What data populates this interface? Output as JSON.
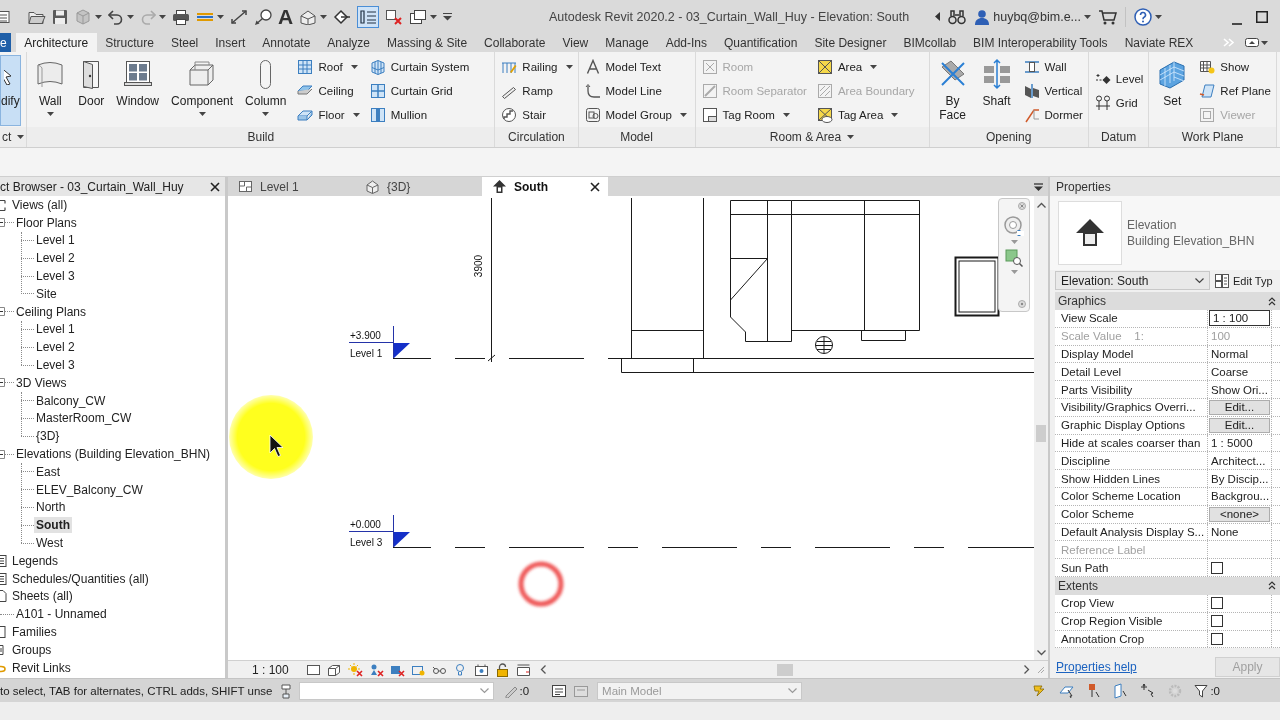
{
  "title_bar": {
    "title": "Autodesk Revit 2020.2 - 03_Curtain_Wall_Huy - Elevation: South",
    "user": "huybq@bim.e..."
  },
  "quick_access": {
    "text_glyph": "A",
    "thin_lines": true
  },
  "ribbon_tabs": [
    {
      "label": "e",
      "kind": "file",
      "selected": false
    },
    {
      "label": "Architecture",
      "kind": "tab",
      "selected": true
    },
    {
      "label": "Structure",
      "kind": "tab",
      "selected": false
    },
    {
      "label": "Steel",
      "kind": "tab",
      "selected": false
    },
    {
      "label": "Insert",
      "kind": "tab",
      "selected": false
    },
    {
      "label": "Annotate",
      "kind": "tab",
      "selected": false
    },
    {
      "label": "Analyze",
      "kind": "tab",
      "selected": false
    },
    {
      "label": "Massing & Site",
      "kind": "tab",
      "selected": false
    },
    {
      "label": "Collaborate",
      "kind": "tab",
      "selected": false
    },
    {
      "label": "View",
      "kind": "tab",
      "selected": false
    },
    {
      "label": "Manage",
      "kind": "tab",
      "selected": false
    },
    {
      "label": "Add-Ins",
      "kind": "tab",
      "selected": false
    },
    {
      "label": "Quantification",
      "kind": "tab",
      "selected": false
    },
    {
      "label": "Site Designer",
      "kind": "tab",
      "selected": false
    },
    {
      "label": "BIMcollab",
      "kind": "tab",
      "selected": false
    },
    {
      "label": "BIM Interoperability Tools",
      "kind": "tab",
      "selected": false
    },
    {
      "label": "Naviate REX",
      "kind": "tab",
      "selected": false
    }
  ],
  "ribbon_panels": [
    {
      "label": "ct",
      "dropdown": true,
      "tools": [
        {
          "label": "dify",
          "kind": "large",
          "active": true,
          "disabled": false,
          "dropdown": false
        }
      ]
    },
    {
      "label": "Build",
      "dropdown": false,
      "tools": [
        {
          "label": "Wall",
          "kind": "large",
          "active": false,
          "disabled": false,
          "dropdown": true
        },
        {
          "label": "Door",
          "kind": "large",
          "active": false,
          "disabled": false,
          "dropdown": false
        },
        {
          "label": "Window",
          "kind": "large",
          "active": false,
          "disabled": false,
          "dropdown": false
        },
        {
          "label": "Component",
          "kind": "large",
          "active": false,
          "disabled": false,
          "dropdown": true
        },
        {
          "label": "Column",
          "kind": "large",
          "active": false,
          "disabled": false,
          "dropdown": true
        },
        {
          "label": "Roof",
          "kind": "small",
          "active": false,
          "disabled": false,
          "dropdown": true
        },
        {
          "label": "Ceiling",
          "kind": "small",
          "active": false,
          "disabled": false,
          "dropdown": false
        },
        {
          "label": "Floor",
          "kind": "small",
          "active": false,
          "disabled": false,
          "dropdown": true
        },
        {
          "label": "Curtain System",
          "kind": "small",
          "active": false,
          "disabled": false,
          "dropdown": false
        },
        {
          "label": "Curtain Grid",
          "kind": "small",
          "active": false,
          "disabled": false,
          "dropdown": false
        },
        {
          "label": "Mullion",
          "kind": "small",
          "active": false,
          "disabled": false,
          "dropdown": false
        }
      ]
    },
    {
      "label": "Circulation",
      "dropdown": false,
      "tools": [
        {
          "label": "Railing",
          "kind": "small",
          "active": false,
          "disabled": false,
          "dropdown": true
        },
        {
          "label": "Ramp",
          "kind": "small",
          "active": false,
          "disabled": false,
          "dropdown": false
        },
        {
          "label": "Stair",
          "kind": "small",
          "active": false,
          "disabled": false,
          "dropdown": false
        }
      ]
    },
    {
      "label": "Model",
      "dropdown": false,
      "tools": [
        {
          "label": "Model Text",
          "kind": "small",
          "active": false,
          "disabled": false,
          "dropdown": false
        },
        {
          "label": "Model Line",
          "kind": "small",
          "active": false,
          "disabled": false,
          "dropdown": false
        },
        {
          "label": "Model Group",
          "kind": "small",
          "active": false,
          "disabled": false,
          "dropdown": true
        }
      ]
    },
    {
      "label": "Room & Area",
      "dropdown": true,
      "tools": [
        {
          "label": "Room",
          "kind": "small",
          "active": false,
          "disabled": true,
          "dropdown": false
        },
        {
          "label": "Room Separator",
          "kind": "small",
          "active": false,
          "disabled": true,
          "dropdown": false
        },
        {
          "label": "Tag Room",
          "kind": "small",
          "active": false,
          "disabled": false,
          "dropdown": true
        },
        {
          "label": "Area",
          "kind": "small",
          "active": false,
          "disabled": false,
          "dropdown": true
        },
        {
          "label": "Area Boundary",
          "kind": "small",
          "active": false,
          "disabled": true,
          "dropdown": false
        },
        {
          "label": "Tag Area",
          "kind": "small",
          "active": false,
          "disabled": false,
          "dropdown": true
        }
      ]
    },
    {
      "label": "Opening",
      "dropdown": false,
      "tools": [
        {
          "label": "By Face",
          "kind": "large",
          "active": false,
          "disabled": false,
          "dropdown": false
        },
        {
          "label": "Shaft",
          "kind": "large",
          "active": false,
          "disabled": false,
          "dropdown": false
        },
        {
          "label": "Wall",
          "kind": "small",
          "active": false,
          "disabled": false,
          "dropdown": false
        },
        {
          "label": "Vertical",
          "kind": "small",
          "active": false,
          "disabled": false,
          "dropdown": false
        },
        {
          "label": "Dormer",
          "kind": "small",
          "active": false,
          "disabled": false,
          "dropdown": false
        }
      ]
    },
    {
      "label": "Datum",
      "dropdown": false,
      "tools": [
        {
          "label": "Level",
          "kind": "small",
          "active": false,
          "disabled": false,
          "dropdown": false
        },
        {
          "label": "Grid",
          "kind": "small",
          "active": false,
          "disabled": false,
          "dropdown": false
        }
      ]
    },
    {
      "label": "Work Plane",
      "dropdown": false,
      "tools": [
        {
          "label": "Set",
          "kind": "large",
          "active": false,
          "disabled": false,
          "dropdown": false
        },
        {
          "label": "Show",
          "kind": "small",
          "active": false,
          "disabled": false,
          "dropdown": false
        },
        {
          "label": "Ref Plane",
          "kind": "small",
          "active": false,
          "disabled": false,
          "dropdown": false
        },
        {
          "label": "Viewer",
          "kind": "small",
          "active": false,
          "disabled": true,
          "dropdown": false
        }
      ]
    }
  ],
  "project_browser": {
    "title": "ct Browser - 03_Curtain_Wall_Huy",
    "tree": [
      {
        "label": "Views (all)",
        "selected": false,
        "children": [
          {
            "label": "Floor Plans",
            "selected": false,
            "children": [
              {
                "label": "Level 1",
                "selected": false
              },
              {
                "label": "Level 2",
                "selected": false
              },
              {
                "label": "Level 3",
                "selected": false
              },
              {
                "label": "Site",
                "selected": false
              }
            ]
          },
          {
            "label": "Ceiling Plans",
            "selected": false,
            "children": [
              {
                "label": "Level 1",
                "selected": false
              },
              {
                "label": "Level 2",
                "selected": false
              },
              {
                "label": "Level 3",
                "selected": false
              }
            ]
          },
          {
            "label": "3D Views",
            "selected": false,
            "children": [
              {
                "label": "Balcony_CW",
                "selected": false
              },
              {
                "label": "MasterRoom_CW",
                "selected": false
              },
              {
                "label": "{3D}",
                "selected": false
              }
            ]
          },
          {
            "label": "Elevations (Building Elevation_BHN)",
            "selected": false,
            "children": [
              {
                "label": "East",
                "selected": false
              },
              {
                "label": "ELEV_Balcony_CW",
                "selected": false
              },
              {
                "label": "North",
                "selected": false
              },
              {
                "label": "South",
                "selected": true
              },
              {
                "label": "West",
                "selected": false
              }
            ]
          }
        ]
      },
      {
        "label": "Legends",
        "selected": false
      },
      {
        "label": "Schedules/Quantities (all)",
        "selected": false
      },
      {
        "label": "Sheets (all)",
        "selected": false,
        "children": [
          {
            "label": "A101 - Unnamed",
            "selected": false
          }
        ]
      },
      {
        "label": "Families",
        "selected": false
      },
      {
        "label": "Groups",
        "selected": false
      },
      {
        "label": "Revit Links",
        "selected": false
      }
    ]
  },
  "view_tabs": [
    {
      "label": "Level 1",
      "kind": "plan",
      "selected": false
    },
    {
      "label": "{3D}",
      "kind": "isometric",
      "selected": false
    },
    {
      "label": "South",
      "kind": "elevation",
      "selected": true
    }
  ],
  "canvas": {
    "dimension": "3900",
    "levels": [
      {
        "elevation": "+3.900",
        "name": "Level 1"
      },
      {
        "elevation": "+0.000",
        "name": "Level 3"
      }
    ]
  },
  "view_control_bar": {
    "scale": "1 : 100"
  },
  "properties": {
    "title": "Properties",
    "type_category": "Elevation",
    "type_name": "Building Elevation_BHN",
    "instance": "Elevation: South",
    "edit_type": "Edit Typ",
    "groups": [
      {
        "name": "Graphics",
        "expanded": true,
        "rows": [
          {
            "label": "View Scale",
            "kind": "input",
            "value": "1 : 100",
            "disabled": false
          },
          {
            "label": "Scale Value    1:",
            "kind": "text",
            "value": "100",
            "disabled": true
          },
          {
            "label": "Display Model",
            "kind": "text",
            "value": "Normal",
            "disabled": false
          },
          {
            "label": "Detail Level",
            "kind": "text",
            "value": "Coarse",
            "disabled": false
          },
          {
            "label": "Parts Visibility",
            "kind": "text",
            "value": "Show Ori...",
            "disabled": false
          },
          {
            "label": "Visibility/Graphics Overri...",
            "kind": "button",
            "value": "Edit...",
            "disabled": false
          },
          {
            "label": "Graphic Display Options",
            "kind": "button",
            "value": "Edit...",
            "disabled": false
          },
          {
            "label": "Hide at scales coarser than",
            "kind": "text",
            "value": "1 : 5000",
            "disabled": false
          },
          {
            "label": "Discipline",
            "kind": "text",
            "value": "Architect...",
            "disabled": false
          },
          {
            "label": "Show Hidden Lines",
            "kind": "text",
            "value": "By Discip...",
            "disabled": false
          },
          {
            "label": "Color Scheme Location",
            "kind": "text",
            "value": "Backgrou...",
            "disabled": false
          },
          {
            "label": "Color Scheme",
            "kind": "button",
            "value": "<none>",
            "disabled": false
          },
          {
            "label": "Default Analysis Display S...",
            "kind": "text",
            "value": "None",
            "disabled": false
          },
          {
            "label": "Reference Label",
            "kind": "text",
            "disabled": true
          },
          {
            "label": "Sun Path",
            "kind": "checkbox",
            "checked": false,
            "disabled": false
          }
        ]
      },
      {
        "name": "Extents",
        "expanded": true,
        "rows": [
          {
            "label": "Crop View",
            "kind": "checkbox",
            "checked": false,
            "disabled": false
          },
          {
            "label": "Crop Region Visible",
            "kind": "checkbox",
            "checked": false,
            "disabled": false
          },
          {
            "label": "Annotation Crop",
            "kind": "checkbox",
            "checked": false,
            "disabled": false
          }
        ]
      }
    ],
    "help": "Properties help",
    "apply": {
      "label": "Apply",
      "disabled": true
    }
  },
  "status_bar": {
    "prompt": "to select, TAB for alternates, CTRL adds, SHIFT unse",
    "editable_count": ":0",
    "design_option": {
      "value": "Main Model",
      "disabled": true
    },
    "filter_count": ":0"
  }
}
